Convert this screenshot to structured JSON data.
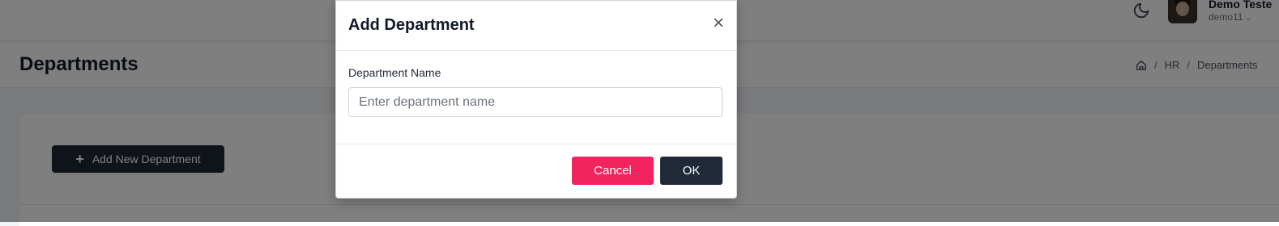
{
  "user": {
    "name": "Demo Teste",
    "handle": "demo11"
  },
  "page": {
    "title": "Departments"
  },
  "breadcrumb": {
    "items": [
      "HR",
      "Departments"
    ]
  },
  "main": {
    "add_button_label": "Add New Department"
  },
  "modal": {
    "title": "Add Department",
    "close_symbol": "×",
    "field_label": "Department Name",
    "input_placeholder": "Enter department name",
    "input_value": "",
    "cancel_label": "Cancel",
    "ok_label": "OK"
  },
  "colors": {
    "cancel": "#f1245f",
    "primary_dark": "#1f2937"
  },
  "icons": [
    "moon-icon",
    "chevron-down-icon",
    "home-icon",
    "plus-icon",
    "close-icon"
  ]
}
